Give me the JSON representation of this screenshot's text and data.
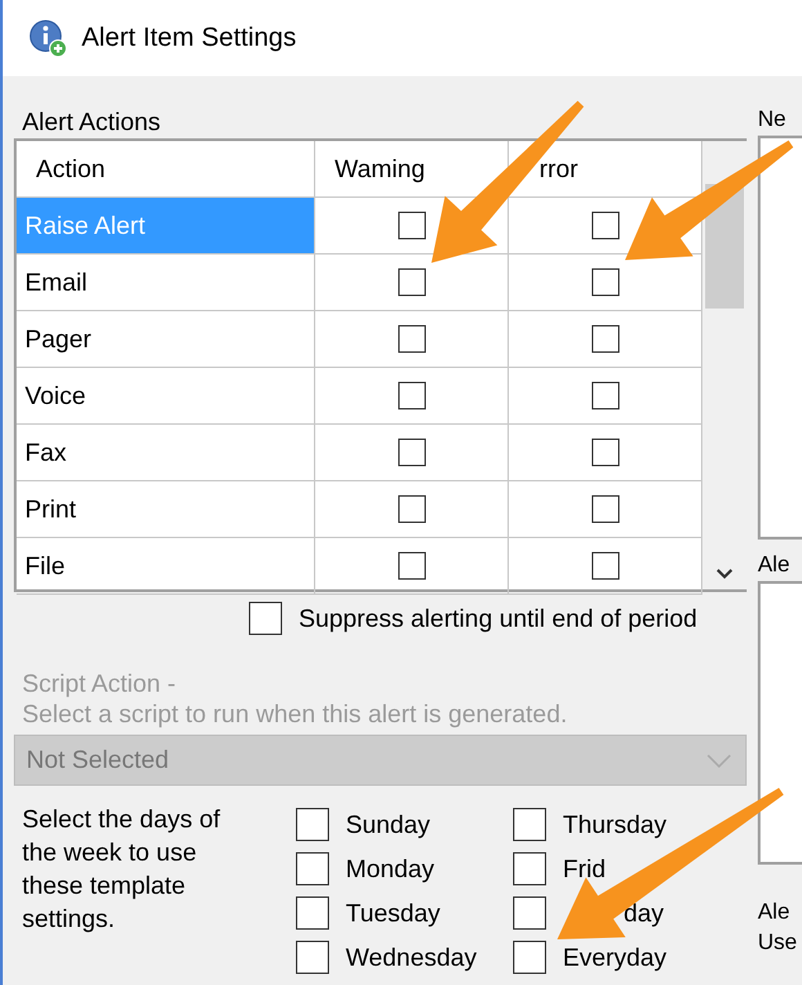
{
  "window": {
    "title": "Alert Item Settings"
  },
  "alert_actions": {
    "label": "Alert Actions",
    "columns": [
      "Action",
      "Waming",
      "rror"
    ],
    "rows": [
      {
        "action": "Raise Alert",
        "selected": true,
        "warning": false,
        "error": false
      },
      {
        "action": "Email",
        "selected": false,
        "warning": false,
        "error": false
      },
      {
        "action": "Pager",
        "selected": false,
        "warning": false,
        "error": false
      },
      {
        "action": "Voice",
        "selected": false,
        "warning": false,
        "error": false
      },
      {
        "action": "Fax",
        "selected": false,
        "warning": false,
        "error": false
      },
      {
        "action": "Print",
        "selected": false,
        "warning": false,
        "error": false
      },
      {
        "action": "File",
        "selected": false,
        "warning": false,
        "error": false
      }
    ]
  },
  "suppress": {
    "label": "Suppress alerting until end of period",
    "checked": false
  },
  "script_action": {
    "label": "Script Action -",
    "hint": "Select a script to run when this alert is generated.",
    "disabled": true,
    "value": "Not Selected"
  },
  "days": {
    "label": "Select the days of the week to use these template settings.",
    "options": [
      {
        "label": "Sunday",
        "checked": false
      },
      {
        "label": "Monday",
        "checked": false
      },
      {
        "label": "Tuesday",
        "checked": false
      },
      {
        "label": "Wednesday",
        "checked": false
      },
      {
        "label": "Thursday",
        "checked": false
      },
      {
        "label": "Frid",
        "checked": false
      },
      {
        "label": "day",
        "checked": false
      },
      {
        "label": "Everyday",
        "checked": false
      }
    ]
  },
  "right_panel": {
    "boxes": [
      {
        "label": "Ne"
      },
      {
        "label": "Ale"
      }
    ],
    "footer_lines": [
      "Ale",
      "Use"
    ]
  },
  "annotations": [
    {
      "kind": "arrow"
    },
    {
      "kind": "arrow"
    },
    {
      "kind": "arrow"
    }
  ]
}
